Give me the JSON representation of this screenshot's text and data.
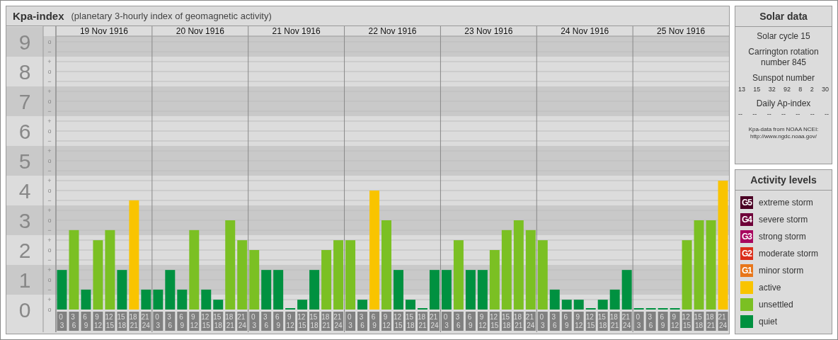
{
  "header": {
    "title": "Kpa-index",
    "subtitle": "(planetary 3-hourly index of geomagnetic activity)"
  },
  "kp_chart": {
    "days": [
      "19 Nov 1916",
      "20 Nov 1916",
      "21 Nov 1916",
      "22 Nov 1916",
      "23 Nov 1916",
      "24 Nov 1916",
      "25 Nov 1916"
    ],
    "minor_labels": [
      "o",
      "−",
      "+",
      "o",
      "−",
      "+",
      "o",
      "−",
      "+",
      "o",
      "−",
      "+",
      "o",
      "−",
      "+",
      "o",
      "−",
      "+",
      "o",
      "−",
      "+",
      "o",
      "−",
      "+",
      "o",
      "−",
      "+",
      "o"
    ],
    "chart_data": {
      "type": "bar",
      "grid": true,
      "ylim": [
        0,
        9
      ],
      "categories": [
        "0 3",
        "3 6",
        "6 9",
        "9 12",
        "12 15",
        "15 18",
        "18 21",
        "21 24",
        "0 3",
        "3 6",
        "6 9",
        "9 12",
        "12 15",
        "15 18",
        "18 21",
        "21 24",
        "0 3",
        "3 6",
        "6 9",
        "9 12",
        "12 15",
        "15 18",
        "18 21",
        "21 24",
        "0 3",
        "3 6",
        "6 9",
        "9 12",
        "12 15",
        "15 18",
        "18 21",
        "21 24",
        "0 3",
        "3 6",
        "6 9",
        "9 12",
        "12 15",
        "15 18",
        "18 21",
        "21 24",
        "0 3",
        "3 6",
        "6 9",
        "9 12",
        "12 15",
        "15 18",
        "18 21",
        "21 24",
        "0 3",
        "3 6",
        "6 9",
        "9 12",
        "12 15",
        "15 18",
        "18 21",
        "21 24"
      ],
      "yticks": [
        9,
        8,
        7,
        6,
        5,
        4,
        3,
        2,
        1,
        0
      ],
      "series": [
        {
          "color": "#009140",
          "values": [
            1.33,
            null,
            0.67,
            null,
            null,
            1.33,
            null,
            0.67,
            0.67,
            1.33,
            0.67,
            null,
            0.67,
            0.33,
            null,
            null,
            null,
            1.33,
            1.33,
            0,
            0.33,
            1.33,
            null,
            null,
            null,
            0.33,
            null,
            null,
            1.33,
            0.33,
            0,
            1.33,
            1.33,
            null,
            1.33,
            1.33,
            null,
            null,
            null,
            null,
            null,
            0.67,
            0.33,
            0.33,
            0,
            0.33,
            0.67,
            1.33,
            0,
            0,
            0,
            0,
            null,
            null,
            null,
            null
          ]
        },
        {
          "color": "#7bc023",
          "values": [
            null,
            2.67,
            null,
            2.33,
            2.67,
            null,
            null,
            null,
            null,
            null,
            null,
            2.67,
            null,
            null,
            3,
            2.33,
            2,
            null,
            null,
            null,
            null,
            null,
            2,
            2.33,
            2.33,
            null,
            null,
            3,
            null,
            null,
            null,
            null,
            null,
            2.33,
            null,
            null,
            2,
            2.67,
            3,
            2.67,
            2.33,
            null,
            null,
            null,
            null,
            null,
            null,
            null,
            null,
            null,
            null,
            null,
            2.33,
            3,
            3,
            null
          ]
        },
        {
          "color": "#f9c400",
          "values": [
            null,
            null,
            null,
            null,
            null,
            null,
            3.67,
            null,
            null,
            null,
            null,
            null,
            null,
            null,
            null,
            null,
            null,
            null,
            null,
            null,
            null,
            null,
            null,
            null,
            null,
            null,
            4,
            null,
            null,
            null,
            null,
            null,
            null,
            null,
            null,
            null,
            null,
            null,
            null,
            null,
            null,
            null,
            null,
            null,
            null,
            null,
            null,
            null,
            null,
            null,
            null,
            null,
            null,
            null,
            null,
            4.33
          ]
        }
      ]
    }
  },
  "solar_data": {
    "title": "Solar data",
    "solar_cycle": "Solar cycle 15",
    "carrington": "Carrington rotation number 845",
    "sunspot_title": "Sunspot number",
    "sunspot_numbers": [
      "13",
      "15",
      "32",
      "92",
      "8",
      "2",
      "30"
    ],
    "ap_title": "Daily Ap-index",
    "ap_values": [
      "--",
      "--",
      "--",
      "--",
      "--",
      "--",
      "--"
    ],
    "source": "Kpa-data from NOAA NCEI: http://www.ngdc.noaa.gov/"
  },
  "activity_levels": {
    "title": "Activity levels",
    "items": [
      {
        "badge": "G5",
        "label": "extreme storm",
        "color": "#4a0024"
      },
      {
        "badge": "G4",
        "label": "severe storm",
        "color": "#6e0039"
      },
      {
        "badge": "G3",
        "label": "strong storm",
        "color": "#a8065f"
      },
      {
        "badge": "G2",
        "label": "moderate storm",
        "color": "#db2e1a"
      },
      {
        "badge": "G1",
        "label": "minor storm",
        "color": "#e8761a"
      },
      {
        "label": "active",
        "color": "#f9c400"
      },
      {
        "label": "unsettled",
        "color": "#7bc023"
      },
      {
        "label": "quiet",
        "color": "#009140"
      }
    ]
  }
}
